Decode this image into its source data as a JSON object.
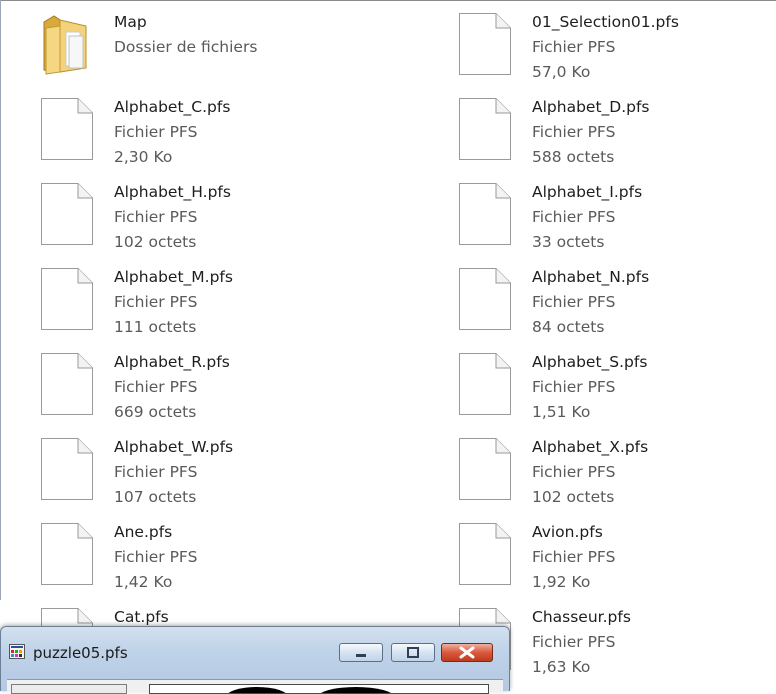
{
  "window_title": "puzzle05.pfs",
  "left_column": [
    {
      "name": "Map",
      "line2": "Dossier de fichiers",
      "line3": "",
      "icon": "folder-icon"
    },
    {
      "name": "Alphabet_C.pfs",
      "line2": "Fichier PFS",
      "line3": "2,30 Ko",
      "icon": "file-icon"
    },
    {
      "name": "Alphabet_H.pfs",
      "line2": "Fichier PFS",
      "line3": "102 octets",
      "icon": "file-icon"
    },
    {
      "name": "Alphabet_M.pfs",
      "line2": "Fichier PFS",
      "line3": "111 octets",
      "icon": "file-icon"
    },
    {
      "name": "Alphabet_R.pfs",
      "line2": "Fichier PFS",
      "line3": "669 octets",
      "icon": "file-icon"
    },
    {
      "name": "Alphabet_W.pfs",
      "line2": "Fichier PFS",
      "line3": "107 octets",
      "icon": "file-icon"
    },
    {
      "name": "Ane.pfs",
      "line2": "Fichier PFS",
      "line3": "1,42 Ko",
      "icon": "file-icon"
    },
    {
      "name": "Cat.pfs",
      "line2": "",
      "line3": "",
      "icon": "file-icon"
    }
  ],
  "right_column": [
    {
      "name": "01_Selection01.pfs",
      "line2": "Fichier PFS",
      "line3": "57,0 Ko",
      "icon": "file-icon"
    },
    {
      "name": "Alphabet_D.pfs",
      "line2": "Fichier PFS",
      "line3": "588 octets",
      "icon": "file-icon"
    },
    {
      "name": "Alphabet_I.pfs",
      "line2": "Fichier PFS",
      "line3": "33 octets",
      "icon": "file-icon"
    },
    {
      "name": "Alphabet_N.pfs",
      "line2": "Fichier PFS",
      "line3": "84 octets",
      "icon": "file-icon"
    },
    {
      "name": "Alphabet_S.pfs",
      "line2": "Fichier PFS",
      "line3": "1,51 Ko",
      "icon": "file-icon"
    },
    {
      "name": "Alphabet_X.pfs",
      "line2": "Fichier PFS",
      "line3": "102 octets",
      "icon": "file-icon"
    },
    {
      "name": "Avion.pfs",
      "line2": "Fichier PFS",
      "line3": "1,92 Ko",
      "icon": "file-icon"
    },
    {
      "name": "Chasseur.pfs",
      "line2": "Fichier PFS",
      "line3": "1,63 Ko",
      "icon": "file-icon"
    }
  ]
}
